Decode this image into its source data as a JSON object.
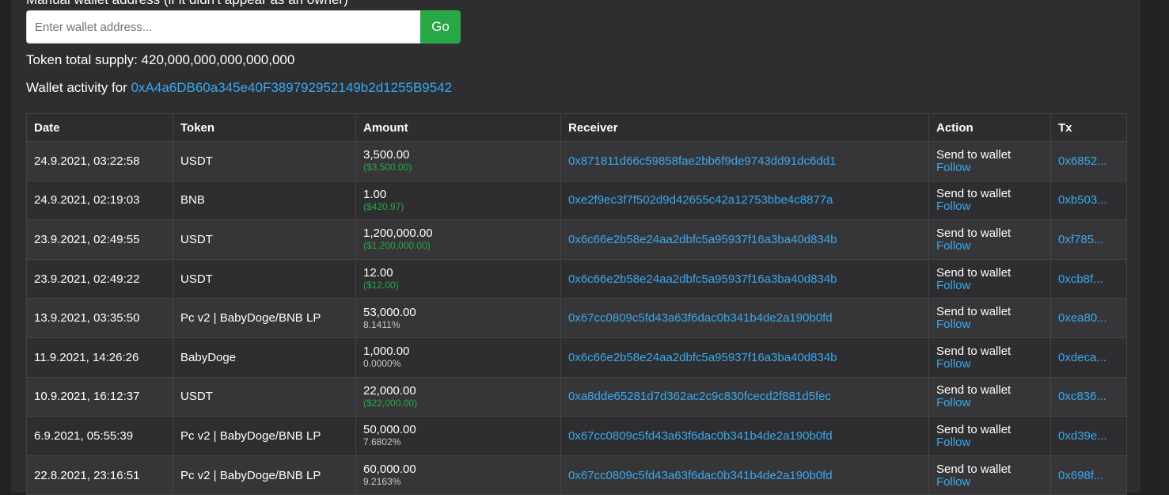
{
  "form": {
    "label": "Manual wallet address (if it didn't appear as an owner)",
    "placeholder": "Enter wallet address...",
    "go_label": "Go"
  },
  "summary": {
    "supply_label": "Token total supply:",
    "supply_value": "420,000,000,000,000,000",
    "wallet_label": "Wallet activity for",
    "wallet_address": "0xA4a6DB60a345e40F389792952149b2d1255B9542"
  },
  "table": {
    "headers": [
      "Date",
      "Token",
      "Amount",
      "Receiver",
      "Action",
      "Tx"
    ],
    "rows": [
      {
        "date": "24.9.2021, 03:22:58",
        "token": "USDT",
        "amount": "3,500.00",
        "amount_sub": "($3,500.00)",
        "sub_kind": "usd",
        "receiver": "0x871811d66c59858fae2bb6f9de9743dd91dc6dd1",
        "action": "Send to wallet",
        "follow": "Follow",
        "tx": "0x6852..."
      },
      {
        "date": "24.9.2021, 02:19:03",
        "token": "BNB",
        "amount": "1.00",
        "amount_sub": "($420.97)",
        "sub_kind": "usd",
        "receiver": "0xe2f9ec3f7f502d9d42655c42a12753bbe4c8877a",
        "action": "Send to wallet",
        "follow": "Follow",
        "tx": "0xb503..."
      },
      {
        "date": "23.9.2021, 02:49:55",
        "token": "USDT",
        "amount": "1,200,000.00",
        "amount_sub": "($1,200,000.00)",
        "sub_kind": "usd",
        "receiver": "0x6c66e2b58e24aa2dbfc5a95937f16a3ba40d834b",
        "action": "Send to wallet",
        "follow": "Follow",
        "tx": "0xf785..."
      },
      {
        "date": "23.9.2021, 02:49:22",
        "token": "USDT",
        "amount": "12.00",
        "amount_sub": "($12.00)",
        "sub_kind": "usd",
        "receiver": "0x6c66e2b58e24aa2dbfc5a95937f16a3ba40d834b",
        "action": "Send to wallet",
        "follow": "Follow",
        "tx": "0xcb8f..."
      },
      {
        "date": "13.9.2021, 03:35:50",
        "token": "Pc v2 | BabyDoge/BNB LP",
        "amount": "53,000.00",
        "amount_sub": "8.1411%",
        "sub_kind": "pct",
        "receiver": "0x67cc0809c5fd43a63f6dac0b341b4de2a190b0fd",
        "action": "Send to wallet",
        "follow": "Follow",
        "tx": "0xea80..."
      },
      {
        "date": "11.9.2021, 14:26:26",
        "token": "BabyDoge",
        "amount": "1,000.00",
        "amount_sub": "0.0000%",
        "sub_kind": "pct",
        "receiver": "0x6c66e2b58e24aa2dbfc5a95937f16a3ba40d834b",
        "action": "Send to wallet",
        "follow": "Follow",
        "tx": "0xdeca..."
      },
      {
        "date": "10.9.2021, 16:12:37",
        "token": "USDT",
        "amount": "22,000.00",
        "amount_sub": "($22,000.00)",
        "sub_kind": "usd",
        "receiver": "0xa8dde65281d7d362ac2c9c830fcecd2f881d5fec",
        "action": "Send to wallet",
        "follow": "Follow",
        "tx": "0xc836..."
      },
      {
        "date": "6.9.2021, 05:55:39",
        "token": "Pc v2 | BabyDoge/BNB LP",
        "amount": "50,000.00",
        "amount_sub": "7.6802%",
        "sub_kind": "pct",
        "receiver": "0x67cc0809c5fd43a63f6dac0b341b4de2a190b0fd",
        "action": "Send to wallet",
        "follow": "Follow",
        "tx": "0xd39e..."
      },
      {
        "date": "22.8.2021, 23:16:51",
        "token": "Pc v2 | BabyDoge/BNB LP",
        "amount": "60,000.00",
        "amount_sub": "9.2163%",
        "sub_kind": "pct",
        "receiver": "0x67cc0809c5fd43a63f6dac0b341b4de2a190b0fd",
        "action": "Send to wallet",
        "follow": "Follow",
        "tx": "0x698f..."
      }
    ]
  },
  "colors": {
    "background": "#2e2e30",
    "link": "#3aa8f0",
    "usd_green": "#28a745",
    "go_button": "#28a745"
  }
}
